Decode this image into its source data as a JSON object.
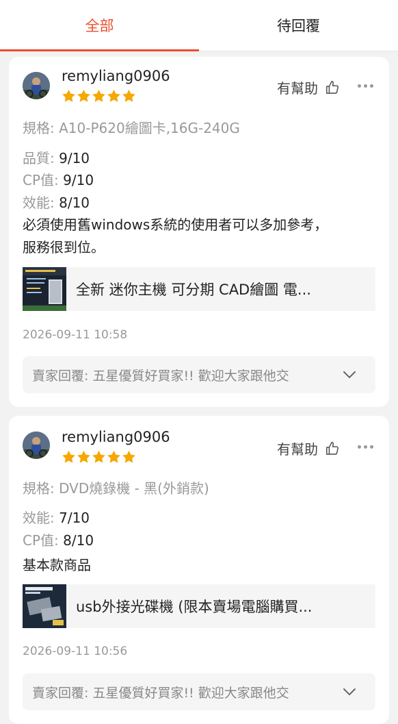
{
  "tabs": [
    {
      "label": "全部",
      "active": true
    },
    {
      "label": "待回覆",
      "active": false
    }
  ],
  "accent_color": "#ee4d2d",
  "star_color": "#f6a700",
  "reviews": [
    {
      "username": "remyliang0906",
      "rating": 5,
      "helpful_label": "有幫助",
      "spec_label": "規格:",
      "spec_value": "A10-P620繪圖卡,16G-240G",
      "ratings": [
        {
          "label": "品質:",
          "value": "9/10"
        },
        {
          "label": "CP值:",
          "value": "9/10"
        },
        {
          "label": "效能:",
          "value": "8/10"
        }
      ],
      "comment_lines": [
        "必須使用舊windows系統的使用者可以多加參考，",
        "服務很到位。"
      ],
      "product_title": "全新 迷你主機 可分期 CAD繪圖 電...",
      "date": "2026-09-11 10:58",
      "seller_reply": "賣家回覆: 五星優質好買家!! 歡迎大家跟他交"
    },
    {
      "username": "remyliang0906",
      "rating": 5,
      "helpful_label": "有幫助",
      "spec_label": "規格:",
      "spec_value": "DVD燒錄機 - 黑(外銷款)",
      "ratings": [
        {
          "label": "效能:",
          "value": "7/10"
        },
        {
          "label": "CP值:",
          "value": "8/10"
        }
      ],
      "comment_lines": [
        "基本款商品"
      ],
      "product_title": "usb外接光碟機 (限本賣場電腦購買...",
      "date": "2026-09-11 10:56",
      "seller_reply": "賣家回覆: 五星優質好買家!! 歡迎大家跟他交"
    }
  ]
}
